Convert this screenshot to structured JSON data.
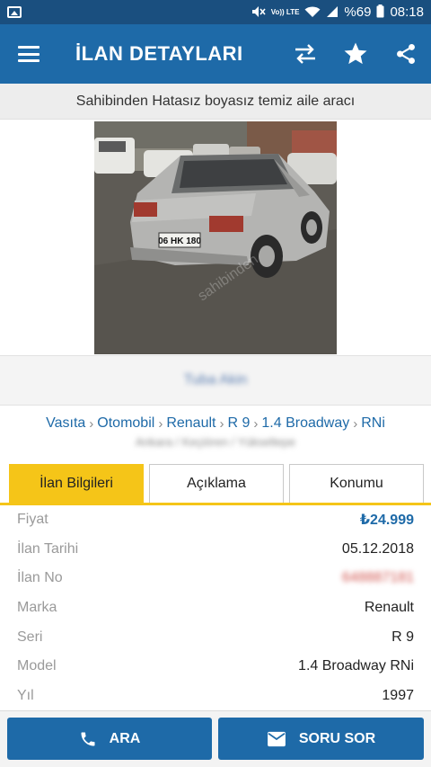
{
  "status_bar": {
    "volte": "Vo)) LTE",
    "battery": "%69",
    "time": "08:18"
  },
  "app_bar": {
    "title": "İLAN DETAYLARI",
    "icons": [
      "menu-icon",
      "compare-icon",
      "star-icon",
      "share-icon"
    ]
  },
  "listing": {
    "title": "Sahibinden Hatasız boyasız temiz aile aracı",
    "photo_plate": "06 HK 180",
    "photo_watermark": "sahibinden",
    "seller_name": "Tuba Akin",
    "breadcrumb": [
      "Vasıta",
      "Otomobil",
      "Renault",
      "R 9",
      "1.4 Broadway",
      "RNi"
    ],
    "location": "Ankara / Keçiören / Yükseltepe"
  },
  "tabs": [
    {
      "label": "İlan Bilgileri",
      "active": true
    },
    {
      "label": "Açıklama",
      "active": false
    },
    {
      "label": "Konumu",
      "active": false
    }
  ],
  "details": [
    {
      "key": "Fiyat",
      "value": "₺24.999"
    },
    {
      "key": "İlan Tarihi",
      "value": "05.12.2018"
    },
    {
      "key": "İlan No",
      "value": "648887181"
    },
    {
      "key": "Marka",
      "value": "Renault"
    },
    {
      "key": "Seri",
      "value": "R 9"
    },
    {
      "key": "Model",
      "value": "1.4 Broadway RNi"
    },
    {
      "key": "Yıl",
      "value": "1997"
    }
  ],
  "actions": {
    "call_label": "ARA",
    "message_label": "SORU SOR"
  },
  "colors": {
    "status_bar": "#1a4f7f",
    "primary": "#1e6aa8",
    "accent_tab": "#f5c518",
    "price": "#1e6aa8"
  }
}
